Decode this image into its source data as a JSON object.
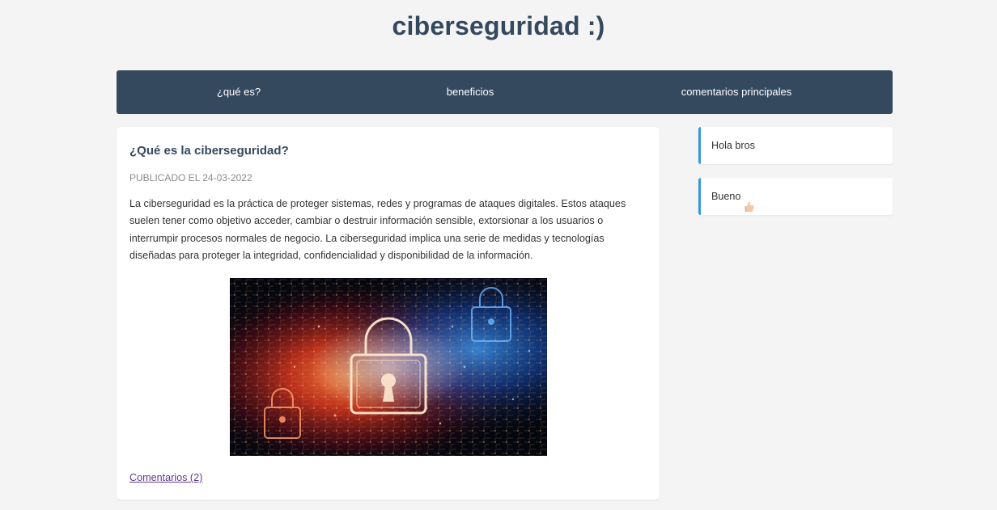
{
  "site": {
    "title": "ciberseguridad :)"
  },
  "nav": {
    "items": [
      {
        "label": "¿qué es?"
      },
      {
        "label": "beneficios"
      },
      {
        "label": "comentarios principales"
      }
    ]
  },
  "article": {
    "title": "¿Qué es la ciberseguridad?",
    "published": "PUBLICADO EL 24-03-2022",
    "body": "La ciberseguridad es la práctica de proteger sistemas, redes y programas de ataques digitales. Estos ataques suelen tener como objetivo acceder, cambiar o destruir información sensible, extorsionar a los usuarios o interrumpir procesos normales de negocio. La ciberseguridad implica una serie de medidas y tecnologías diseñadas para proteger la integridad, confidencialidad y disponibilidad de la información.",
    "image_icon": "padlock-circuit-image",
    "comments_link": "Comentarios (2)"
  },
  "sidebar": {
    "comments": [
      {
        "text": "Hola bros"
      },
      {
        "text": "Bueno",
        "emoji_icon": "thumbs-up-icon"
      }
    ]
  },
  "colors": {
    "title": "#34495e",
    "nav_bg": "#34495e",
    "comment_accent": "#3498db",
    "link": "#5e3d8a",
    "page_bg": "#f4f4f4"
  }
}
